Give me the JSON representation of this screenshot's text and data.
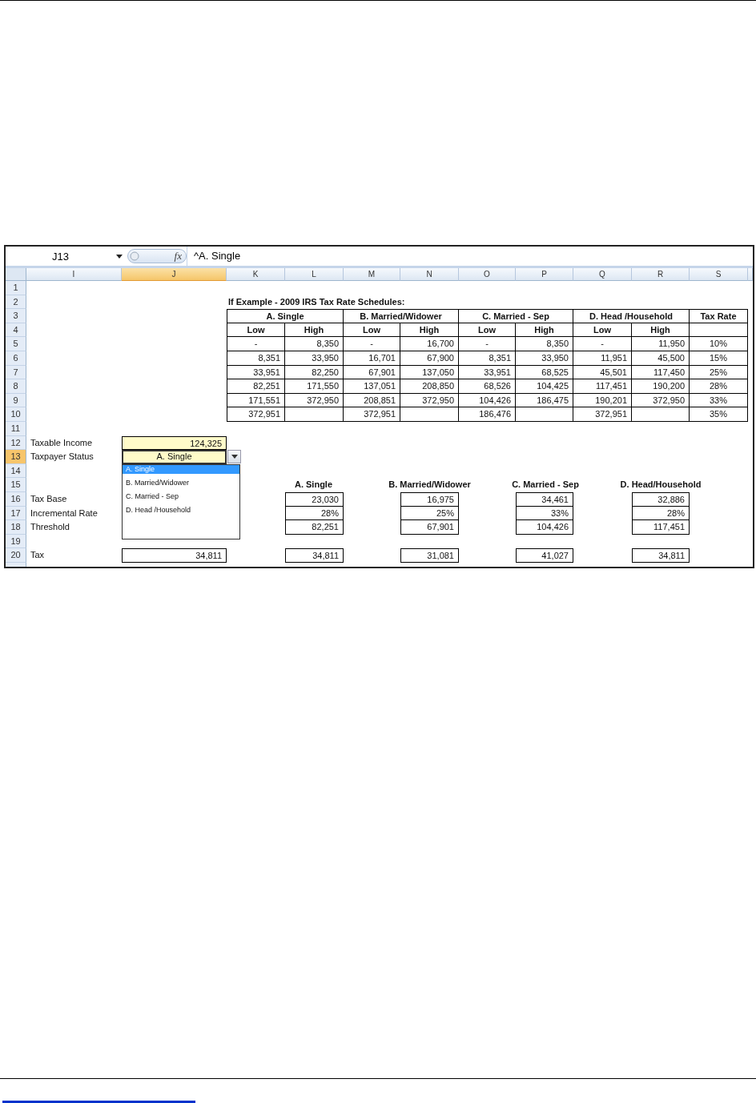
{
  "formula_bar": {
    "name_box": "J13",
    "formula": "^A. Single",
    "function_label": "fx"
  },
  "columns": [
    {
      "label": "I",
      "selected": false
    },
    {
      "label": "J",
      "selected": true
    },
    {
      "label": "K",
      "selected": false
    },
    {
      "label": "L",
      "selected": false
    },
    {
      "label": "M",
      "selected": false
    },
    {
      "label": "N",
      "selected": false
    },
    {
      "label": "O",
      "selected": false
    },
    {
      "label": "P",
      "selected": false
    },
    {
      "label": "Q",
      "selected": false
    },
    {
      "label": "R",
      "selected": false
    },
    {
      "label": "S",
      "selected": false
    }
  ],
  "rows": [
    {
      "label": "1",
      "selected": false
    },
    {
      "label": "2",
      "selected": false
    },
    {
      "label": "3",
      "selected": false
    },
    {
      "label": "4",
      "selected": false
    },
    {
      "label": "5",
      "selected": false
    },
    {
      "label": "6",
      "selected": false
    },
    {
      "label": "7",
      "selected": false
    },
    {
      "label": "8",
      "selected": false
    },
    {
      "label": "9",
      "selected": false
    },
    {
      "label": "10",
      "selected": false
    },
    {
      "label": "11",
      "selected": false
    },
    {
      "label": "12",
      "selected": false
    },
    {
      "label": "13",
      "selected": true
    },
    {
      "label": "14",
      "selected": false
    },
    {
      "label": "15",
      "selected": false
    },
    {
      "label": "16",
      "selected": false
    },
    {
      "label": "17",
      "selected": false
    },
    {
      "label": "18",
      "selected": false
    },
    {
      "label": "19",
      "selected": false
    },
    {
      "label": "20",
      "selected": false
    }
  ],
  "schedule": {
    "title": "If Example - 2009 IRS Tax Rate Schedules:",
    "groups": [
      "A. Single",
      "B. Married/Widower",
      "C. Married - Sep",
      "D. Head /Household"
    ],
    "rate_header": "Tax Rate",
    "subheaders": [
      "Low",
      "High",
      "Low",
      "High",
      "Low",
      "High",
      "Low",
      "High"
    ],
    "rows": [
      [
        "-",
        "8,350",
        "-",
        "16,700",
        "-",
        "8,350",
        "-",
        "11,950",
        "10%"
      ],
      [
        "8,351",
        "33,950",
        "16,701",
        "67,900",
        "8,351",
        "33,950",
        "11,951",
        "45,500",
        "15%"
      ],
      [
        "33,951",
        "82,250",
        "67,901",
        "137,050",
        "33,951",
        "68,525",
        "45,501",
        "117,450",
        "25%"
      ],
      [
        "82,251",
        "171,550",
        "137,051",
        "208,850",
        "68,526",
        "104,425",
        "117,451",
        "190,200",
        "28%"
      ],
      [
        "171,551",
        "372,950",
        "208,851",
        "372,950",
        "104,426",
        "186,475",
        "190,201",
        "372,950",
        "33%"
      ],
      [
        "372,951",
        "",
        "372,951",
        "",
        "186,476",
        "",
        "372,951",
        "",
        "35%"
      ]
    ]
  },
  "inputs": {
    "taxable_income_label": "Taxable Income",
    "taxable_income": "124,325",
    "status_label": "Taxpayer Status",
    "status": "A. Single"
  },
  "dropdown": {
    "options": [
      {
        "label": "A. Single",
        "selected": true
      },
      {
        "label": "B. Married/Widower",
        "selected": false
      },
      {
        "label": "C. Married - Sep",
        "selected": false
      },
      {
        "label": "D. Head /Household",
        "selected": false
      }
    ]
  },
  "results": {
    "row_labels": [
      "Tax Base",
      "Incremental Rate",
      "Threshold"
    ],
    "tax_label": "Tax",
    "tax": "34,811",
    "columns": [
      {
        "header": "A. Single",
        "values": [
          "23,030",
          "28%",
          "82,251"
        ],
        "tax": "34,811"
      },
      {
        "header": "B. Married/Widower",
        "values": [
          "16,975",
          "25%",
          "67,901"
        ],
        "tax": "31,081"
      },
      {
        "header": "C. Married - Sep",
        "values": [
          "34,461",
          "33%",
          "104,426"
        ],
        "tax": "41,027"
      },
      {
        "header": "D. Head/Household",
        "values": [
          "32,886",
          "28%",
          "117,451"
        ],
        "tax": "34,811"
      }
    ]
  }
}
